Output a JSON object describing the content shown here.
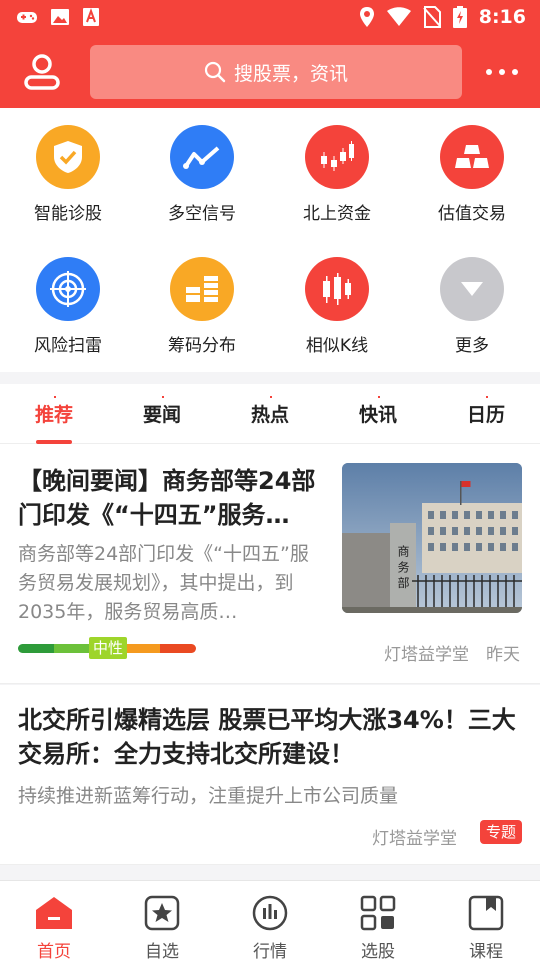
{
  "status_bar": {
    "time": "8:16"
  },
  "header": {
    "search_placeholder": "搜股票，资讯"
  },
  "tools": [
    {
      "label": "智能诊股",
      "icon": "shield-check-icon",
      "color": "#f9a825"
    },
    {
      "label": "多空信号",
      "icon": "trend-signal-icon",
      "color": "#2f7df6"
    },
    {
      "label": "北上资金",
      "icon": "candlestick-icon",
      "color": "#f4433b"
    },
    {
      "label": "估值交易",
      "icon": "gold-bars-icon",
      "color": "#f4433b"
    },
    {
      "label": "风险扫雷",
      "icon": "radar-icon",
      "color": "#2f7df6"
    },
    {
      "label": "筹码分布",
      "icon": "chip-bars-icon",
      "color": "#f9a825"
    },
    {
      "label": "相似K线",
      "icon": "kline-icon",
      "color": "#f4433b"
    },
    {
      "label": "更多",
      "icon": "chevron-down-icon",
      "color": "#bdbdbd"
    }
  ],
  "tabs": [
    {
      "label": "推荐",
      "active": true
    },
    {
      "label": "要闻",
      "active": false
    },
    {
      "label": "热点",
      "active": false
    },
    {
      "label": "快讯",
      "active": false
    },
    {
      "label": "日历",
      "active": false
    }
  ],
  "news": [
    {
      "title": "【晚间要闻】商务部等24部门印发《“十四五”服务…",
      "summary": "商务部等24部门印发《“十四五”服务贸易发展规划》，其中提出，到2035年，服务贸易高质…",
      "sentiment": "中性",
      "source": "灯塔益学堂",
      "time": "昨天",
      "thumb_text": "商 务 部"
    },
    {
      "title": "北交所引爆精选层 股票已平均大涨34%！三大交易所：全力支持北交所建设！",
      "summary": "持续推进新蓝筹行动，注重提升上市公司质量",
      "source": "灯塔益学堂",
      "badge": "专题"
    }
  ],
  "bottom_nav": [
    {
      "label": "首页",
      "icon": "home-icon",
      "active": true
    },
    {
      "label": "自选",
      "icon": "star-icon",
      "active": false
    },
    {
      "label": "行情",
      "icon": "market-bars-icon",
      "active": false
    },
    {
      "label": "选股",
      "icon": "grid-select-icon",
      "active": false
    },
    {
      "label": "课程",
      "icon": "course-book-icon",
      "active": false
    }
  ],
  "colors": {
    "brand": "#f4433b",
    "search_bg": "#f98a82"
  }
}
